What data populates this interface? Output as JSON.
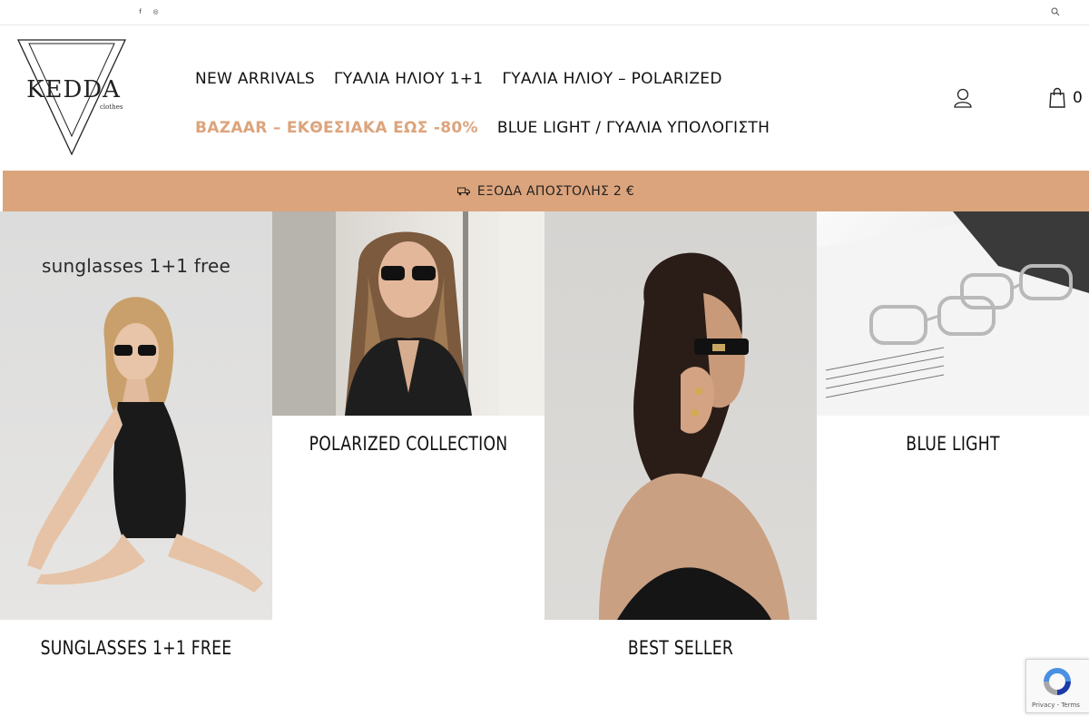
{
  "topbar": {
    "social": [
      "f",
      "◎"
    ],
    "search_icon": "search-icon"
  },
  "logo": {
    "name": "KEDDA",
    "sub": "clothes"
  },
  "nav": {
    "row1": [
      "NEW ARRIVALS",
      "ΓΥΑΛΙΑ ΗΛΙΟΥ 1+1",
      "ΓΥΑΛΙΑ ΗΛΙΟΥ – POLARIZED"
    ],
    "row2": [
      "BAZAAR – ΕΚΘΕΣΙΑΚΑ ΕΩΣ -80%",
      "BLUE LIGHT / ΓΥΑΛΙΑ ΥΠΟΛΟΓΙΣΤΗ"
    ]
  },
  "header": {
    "cart_count": "0"
  },
  "promo": {
    "text": "ΕΞΟΔΑ ΑΠΟΣΤΟΛΗΣ 2 €"
  },
  "tiles": {
    "t1_overlay": "sunglasses 1+1 free",
    "t1_caption": "SUNGLASSES 1+1 FREE",
    "t2_caption": "POLARIZED COLLECTION",
    "t3_caption": "BEST SELLER",
    "t4_caption": "BLUE LIGHT"
  },
  "recaptcha": {
    "links": "Privacy - Terms"
  },
  "colors": {
    "accent": "#dca47c",
    "text": "#111111"
  }
}
